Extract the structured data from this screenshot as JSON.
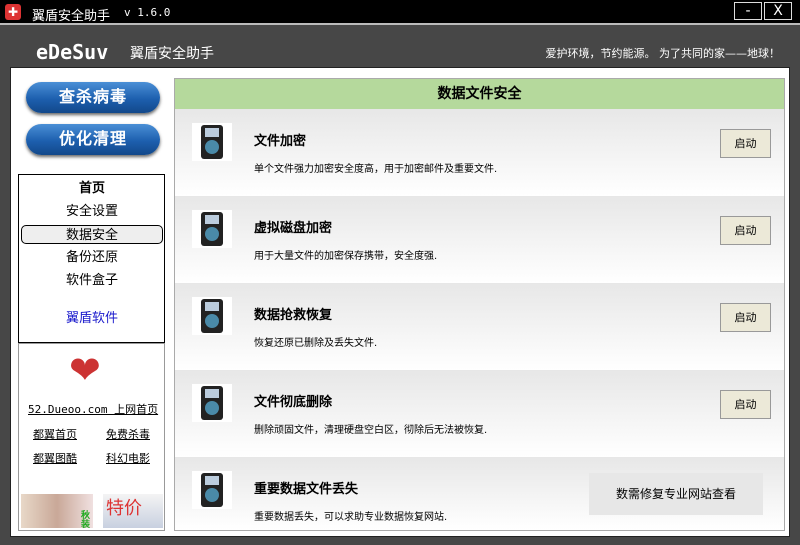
{
  "window": {
    "title": "翼盾安全助手",
    "version": "v 1.6.0",
    "minimize": "-",
    "close": "X"
  },
  "header": {
    "brand": "eDeSuv",
    "brand_cn": "翼盾安全助手",
    "slogan": "爱护环境，节约能源。 为了共同的家——地球！"
  },
  "sidebar": {
    "buttons": [
      "查杀病毒",
      "优化清理"
    ],
    "nav": [
      "首页",
      "安全设置",
      "数据安全",
      "备份还原",
      "软件盒子"
    ],
    "nav_selected": "数据安全",
    "brand_link": "翼盾软件",
    "ad": {
      "main_link": "52.Dueoo.com 上网首页",
      "links": [
        "都翼首页",
        "免费杀毒",
        "都翼图酷",
        "科幻电影"
      ],
      "banner_text": [
        "秋装",
        "特价"
      ]
    }
  },
  "main": {
    "title": "数据文件安全",
    "rows": [
      {
        "title": "文件加密",
        "desc": "单个文件强力加密安全度高，用于加密邮件及重要文件.",
        "button": "启动"
      },
      {
        "title": "虚拟磁盘加密",
        "desc": "用于大量文件的加密保存携带，安全度强.",
        "button": "启动"
      },
      {
        "title": "数据抢救恢复",
        "desc": "恢复还原已删除及丢失文件.",
        "button": "启动"
      },
      {
        "title": "文件彻底删除",
        "desc": "删除顽固文件，清理硬盘空白区，彻除后无法被恢复.",
        "button": "启动"
      },
      {
        "title": "重要数据文件丢失",
        "desc": "重要数据丢失，可以求助专业数据恢复网站.",
        "button": "数需修复专业网站查看"
      }
    ]
  }
}
